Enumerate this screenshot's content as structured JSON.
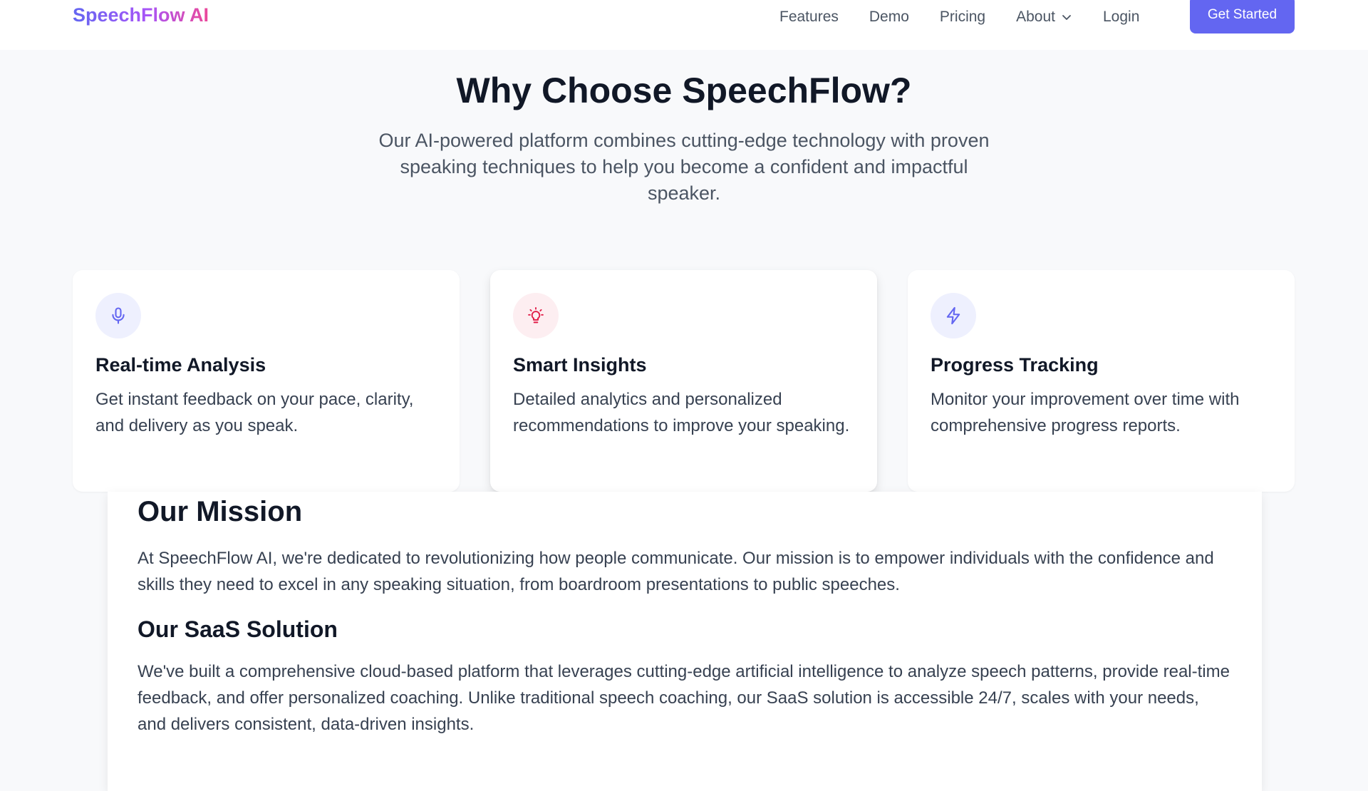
{
  "nav": {
    "brand": "SpeechFlow AI",
    "links": [
      "Features",
      "Demo",
      "Pricing",
      "About",
      "Login"
    ],
    "cta": "Get Started"
  },
  "hero": {
    "title": "Why Choose SpeechFlow?",
    "subtitle": "Our AI-powered platform combines cutting-edge technology with proven speaking techniques to help you become a confident and impactful speaker."
  },
  "features": [
    {
      "icon": "microphone-icon",
      "title": "Real-time Analysis",
      "description": "Get instant feedback on your pace, clarity, and delivery as you speak.",
      "icon_color": "#6366f1",
      "icon_bg": "#eef0fe"
    },
    {
      "icon": "lightbulb-icon",
      "title": "Smart Insights",
      "description": "Detailed analytics and personalized recommendations to improve your speaking.",
      "icon_color": "#e11d48",
      "icon_bg": "#fdeef1"
    },
    {
      "icon": "lightning-icon",
      "title": "Progress Tracking",
      "description": "Monitor your improvement over time with comprehensive progress reports.",
      "icon_color": "#6366f1",
      "icon_bg": "#eef0fe"
    }
  ],
  "mission": {
    "title": "Our Mission",
    "text": "At SpeechFlow AI, we're dedicated to revolutionizing how people communicate. Our mission is to empower individuals with the confidence and skills they need to excel in any speaking situation, from boardroom presentations to public speeches.",
    "solution_title": "Our SaaS Solution",
    "solution_text": "We've built a comprehensive cloud-based platform that leverages cutting-edge artificial intelligence to analyze speech patterns, provide real-time feedback, and offer personalized coaching. Unlike traditional speech coaching, our SaaS solution is accessible 24/7, scales with your needs, and delivers consistent, data-driven insights."
  },
  "colors": {
    "accent": "#6366f1",
    "heading": "#111827",
    "body_text": "#374151",
    "muted_text": "#4b5563",
    "background": "#f8f9fb"
  }
}
